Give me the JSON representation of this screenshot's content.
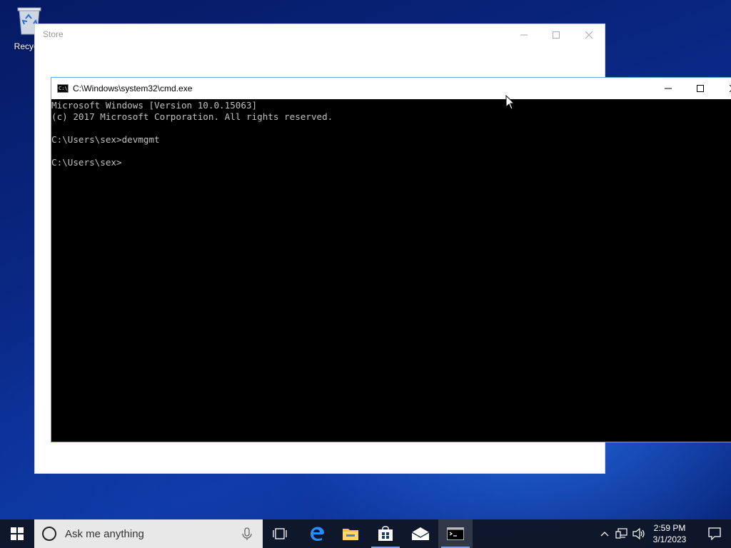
{
  "desktop": {
    "icons": [
      {
        "label": "Recycle"
      }
    ]
  },
  "store_window": {
    "title": "Store",
    "controls": {
      "minimize": "—",
      "maximize": "☐",
      "close": "✕"
    }
  },
  "cmd_window": {
    "title": "C:\\Windows\\system32\\cmd.exe",
    "icon_text": "C:\\",
    "lines": [
      "Microsoft Windows [Version 10.0.15063]",
      "(c) 2017 Microsoft Corporation. All rights reserved.",
      "",
      "C:\\Users\\sex>devmgmt",
      "",
      "C:\\Users\\sex>"
    ]
  },
  "taskbar": {
    "search_placeholder": "Ask me anything",
    "pinned": [
      "task-view",
      "edge",
      "file-explorer",
      "store",
      "mail",
      "command-prompt"
    ],
    "clock": {
      "time": "2:59 PM",
      "date": "3/1/2023"
    }
  },
  "colors": {
    "taskbar_bg": "#101a2e",
    "cmd_text": "#c0c0c0",
    "accent": "#7aa7e0"
  }
}
